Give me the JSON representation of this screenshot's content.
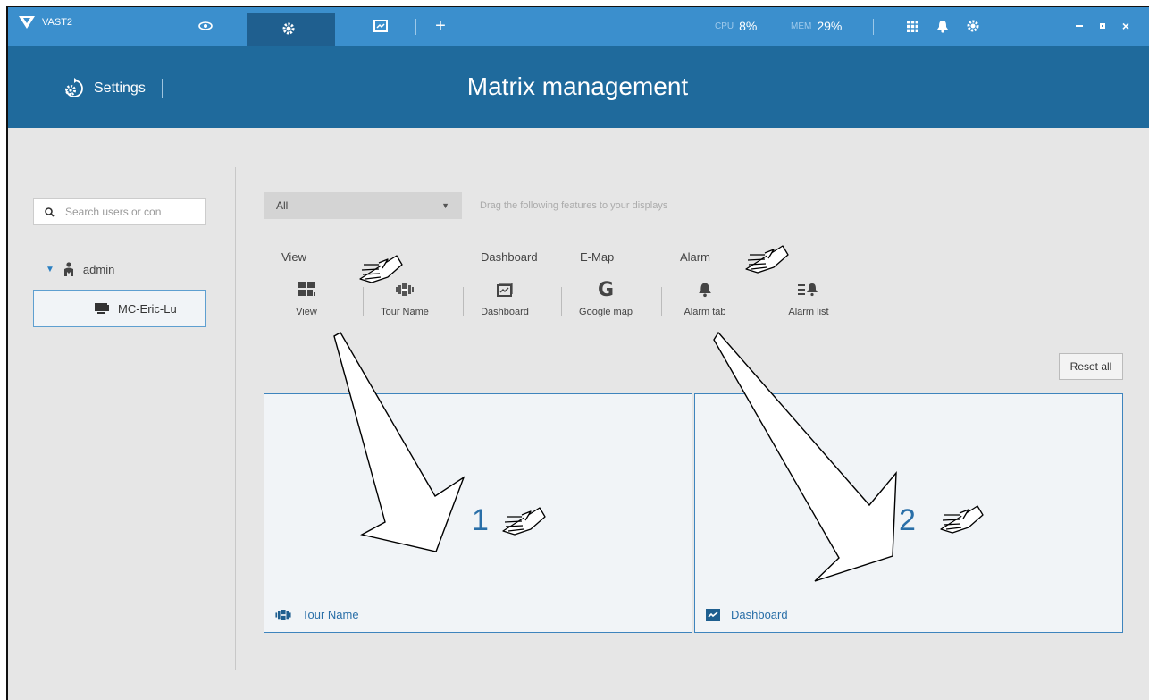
{
  "app": {
    "name": "VAST2"
  },
  "tabs": [
    {
      "name": "liveview",
      "icon": "eye-icon"
    },
    {
      "name": "settings",
      "icon": "gear-icon",
      "active": true
    },
    {
      "name": "dashboard",
      "icon": "chart-icon"
    },
    {
      "name": "add",
      "icon": "plus-icon"
    }
  ],
  "performance": {
    "cpu_label": "CPU",
    "cpu_value": "8%",
    "mem_label": "MEM",
    "mem_value": "29%"
  },
  "header": {
    "section": "Settings",
    "title": "Matrix management"
  },
  "sidebar": {
    "search_placeholder": "Search users or con",
    "user": "admin",
    "device": "MC-Eric-Lu"
  },
  "filter": {
    "selected": "All",
    "hint": "Drag the following features to your displays"
  },
  "categories": [
    "View",
    "Dashboard",
    "E-Map",
    "Alarm"
  ],
  "features": [
    {
      "label": "View",
      "icon": "view-layout-icon"
    },
    {
      "label": "Tour Name",
      "icon": "tour-icon"
    },
    {
      "label": "Dashboard",
      "icon": "dashboard-icon"
    },
    {
      "label": "Google map",
      "icon": "google-icon"
    },
    {
      "label": "Alarm tab",
      "icon": "bell-icon"
    },
    {
      "label": "Alarm list",
      "icon": "alarm-list-icon"
    }
  ],
  "reset_label": "Reset all",
  "displays": [
    {
      "number": "1",
      "content": "Tour Name",
      "icon": "tour-icon"
    },
    {
      "number": "2",
      "content": "Dashboard",
      "icon": "dashboard-icon"
    }
  ],
  "colors": {
    "topbar": "#3b8fcd",
    "header": "#1f6a9c",
    "accent": "#2a6fa8",
    "background": "#e6e6e6"
  }
}
